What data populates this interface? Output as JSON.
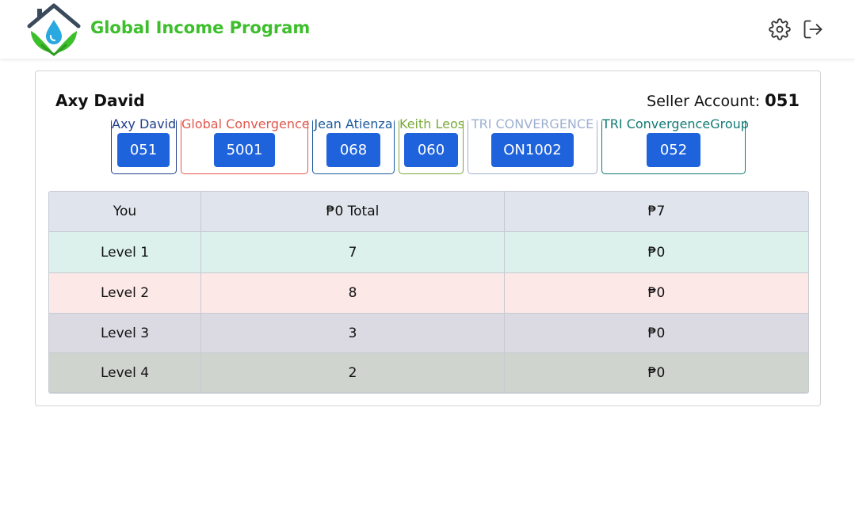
{
  "header": {
    "brand": "Global Income Program"
  },
  "card": {
    "user_name": "Axy David",
    "seller_label": "Seller Account:",
    "seller_number": "051"
  },
  "accounts": [
    {
      "name": "Axy David",
      "code": "051",
      "color": "#1e3f8a"
    },
    {
      "name": "Global Convergence",
      "code": "5001",
      "color": "#e2574c"
    },
    {
      "name": "Jean  Atienza",
      "code": "068",
      "color": "#1c5a9c"
    },
    {
      "name": "Keith Leos",
      "code": "060",
      "color": "#7ba83a"
    },
    {
      "name": "TRI CONVERGENCE",
      "code": "ON1002",
      "color": "#9db0d1"
    },
    {
      "name": "TRI ConvergenceGroup",
      "code": "052",
      "color": "#127a73"
    }
  ],
  "table": {
    "rows": [
      {
        "level": "You",
        "count": "₱0 Total",
        "amount": "₱7",
        "bg": "#e0e4ec"
      },
      {
        "level": "Level 1",
        "count": "7",
        "amount": "₱0",
        "bg": "#dcf1ec"
      },
      {
        "level": "Level 2",
        "count": "8",
        "amount": "₱0",
        "bg": "#fde8e8"
      },
      {
        "level": "Level 3",
        "count": "3",
        "amount": "₱0",
        "bg": "#dbd9e2"
      },
      {
        "level": "Level 4",
        "count": "2",
        "amount": "₱0",
        "bg": "#cfd4cf"
      }
    ]
  },
  "icons": {
    "logo": "house-drop-hands-logo",
    "settings": "gear-icon",
    "logout": "logout-icon"
  }
}
